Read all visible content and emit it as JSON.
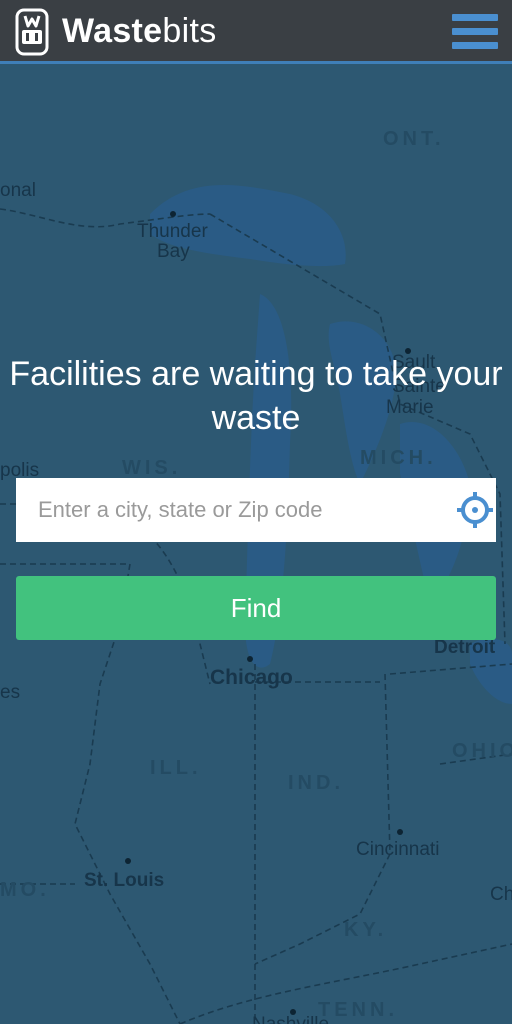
{
  "header": {
    "brand_strong": "Waste",
    "brand_light": "bits"
  },
  "map": {
    "cities": {
      "thunder_bay_line1": "Thunder",
      "thunder_bay_line2": "Bay",
      "sault_line1": "Sault",
      "sault_line2": "Sainte",
      "sault_line3": "Marie",
      "chicago": "Chicago",
      "detroit": "Detroit",
      "st_louis": "St. Louis",
      "cincinnati": "Cincinnati",
      "nashville": "Nashville",
      "polis": "polis",
      "onal": "onal",
      "es": "es",
      "ch": "Ch"
    },
    "states": {
      "ont": "ONT.",
      "mich": "MICH.",
      "wis": "WIS.",
      "ill": "ILL.",
      "ind": "IND.",
      "ohio": "OHIO",
      "mo": "MO.",
      "ky": "KY.",
      "tenn": "TENN."
    }
  },
  "hero": {
    "headline": "Facilities are waiting to take your waste"
  },
  "search": {
    "placeholder": "Enter a city, state or Zip code",
    "value": ""
  },
  "find_button": {
    "label": "Find"
  },
  "colors": {
    "header_bg": "#3a3f44",
    "accent_blue": "#4a8fd0",
    "find_green": "#42c27e",
    "map_overlay": "#2d5872"
  },
  "icons": {
    "logo": "wastebits-logo-icon",
    "menu": "hamburger-menu-icon",
    "locate": "crosshair-locate-icon"
  }
}
